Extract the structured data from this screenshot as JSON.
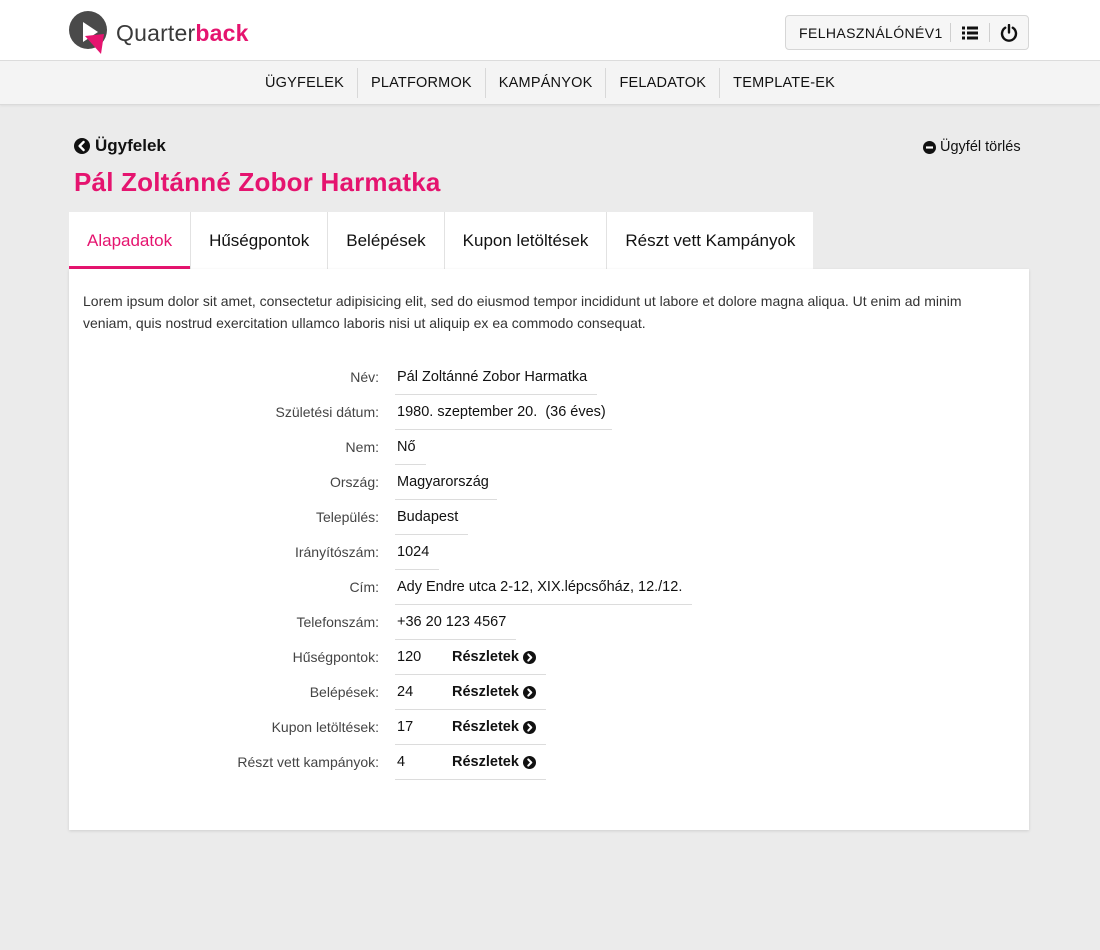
{
  "brand": {
    "name_light": "Quarter",
    "name_bold": "back",
    "accent": "#e5146f"
  },
  "user": {
    "name": "FELHASZNÁLÓNÉV1",
    "list_icon": "list-icon",
    "power_icon": "power-icon"
  },
  "nav": {
    "items": [
      "ÜGYFELEK",
      "PLATFORMOK",
      "KAMPÁNYOK",
      "FELADATOK",
      "TEMPLATE-EK"
    ]
  },
  "page": {
    "back_label": "Ügyfelek",
    "delete_label": "Ügyfél törlés",
    "title": "Pál Zoltánné Zobor Harmatka"
  },
  "tabs": [
    {
      "label": "Alapadatok",
      "active": true
    },
    {
      "label": "Hűségpontok",
      "active": false
    },
    {
      "label": "Belépések",
      "active": false
    },
    {
      "label": "Kupon letöltések",
      "active": false
    },
    {
      "label": "Részt vett Kampányok",
      "active": false
    }
  ],
  "intro": "Lorem ipsum dolor sit amet, consectetur adipisicing elit, sed do eiusmod tempor incididunt ut labore et dolore magna aliqua. Ut enim ad minim veniam, quis nostrud exercitation ullamco laboris nisi ut aliquip ex ea commodo consequat.",
  "fields": [
    {
      "label": "Név:",
      "value": "Pál Zoltánné Zobor Harmatka"
    },
    {
      "label": "Születési dátum:",
      "value": "1980. szeptember 20.  (36 éves)"
    },
    {
      "label": "Nem:",
      "value": "Nő"
    },
    {
      "label": "Ország:",
      "value": "Magyarország"
    },
    {
      "label": "Település:",
      "value": "Budapest"
    },
    {
      "label": "Irányítószám:",
      "value": "1024"
    },
    {
      "label": "Cím:",
      "value": "Ady Endre utca 2-12, XIX.lépcsőház, 12./12."
    },
    {
      "label": "Telefonszám:",
      "value": "+36 20 123 4567"
    }
  ],
  "stats": [
    {
      "label": "Hűségpontok:",
      "value": "120",
      "details": "Részletek"
    },
    {
      "label": "Belépések:",
      "value": "24",
      "details": "Részletek"
    },
    {
      "label": "Kupon letöltések:",
      "value": "17",
      "details": "Részletek"
    },
    {
      "label": "Részt vett kampányok:",
      "value": "4",
      "details": "Részletek"
    }
  ]
}
